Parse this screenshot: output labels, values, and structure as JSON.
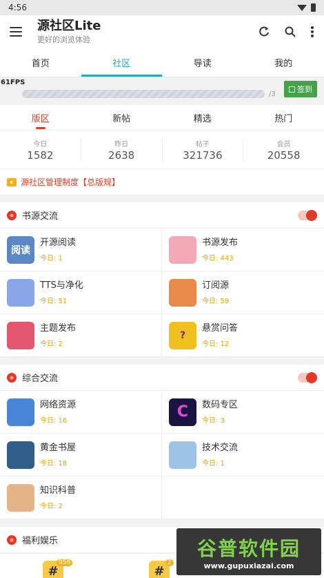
{
  "status": {
    "time": "4:56"
  },
  "appbar": {
    "title": "源社区Lite",
    "subtitle": "更好的浏览体验"
  },
  "tabs": [
    "首页",
    "社区",
    "导读",
    "我的"
  ],
  "progress": {
    "fps": "61FPS",
    "count": "/3",
    "checkin_label": "签到"
  },
  "subtabs": [
    "版区",
    "新帖",
    "精选",
    "热门"
  ],
  "stats": [
    {
      "label": "今日",
      "value": "1582"
    },
    {
      "label": "昨日",
      "value": "2638"
    },
    {
      "label": "帖子",
      "value": "321736"
    },
    {
      "label": "会员",
      "value": "20558"
    }
  ],
  "notice": "源社区管理制度【总版规】",
  "sections": [
    {
      "title": "书源交流",
      "forums": [
        {
          "name": "开源阅读",
          "today": "今日: 1",
          "icon_text": "阅读",
          "color": "#5a88c6"
        },
        {
          "name": "书源发布",
          "today": "今日: 443",
          "icon_text": "",
          "color": "#f1a9b6"
        },
        {
          "name": "TTS与净化",
          "today": "今日: 51",
          "icon_text": "",
          "color": "#8aa6e8"
        },
        {
          "name": "订阅源",
          "today": "今日: 59",
          "icon_text": "",
          "color": "#e98a4a"
        },
        {
          "name": "主题发布",
          "today": "今日: 2",
          "icon_text": "",
          "color": "#e4566d"
        },
        {
          "name": "悬赏问答",
          "today": "今日: 12",
          "icon_text": "?",
          "color": "#f0c020"
        }
      ]
    },
    {
      "title": "综合交流",
      "forums": [
        {
          "name": "网络资源",
          "today": "今日: 16",
          "icon_text": "",
          "color": "#4a86d8"
        },
        {
          "name": "数码专区",
          "today": "今日: 3",
          "icon_text": "C",
          "color": "#1b1440"
        },
        {
          "name": "黄金书屋",
          "today": "今日: 18",
          "icon_text": "",
          "color": "#2f5f8a"
        },
        {
          "name": "技术交流",
          "today": "今日: 1",
          "icon_text": "",
          "color": "#9cc3e6"
        },
        {
          "name": "知识科普",
          "today": "今日: 2",
          "icon_text": "",
          "color": "#e7b48a"
        }
      ]
    },
    {
      "title": "福利娱乐",
      "badges": [
        "958",
        "2"
      ]
    }
  ],
  "watermark": {
    "big": "谷普软件园",
    "small": "www.gupuxiazai.com"
  }
}
